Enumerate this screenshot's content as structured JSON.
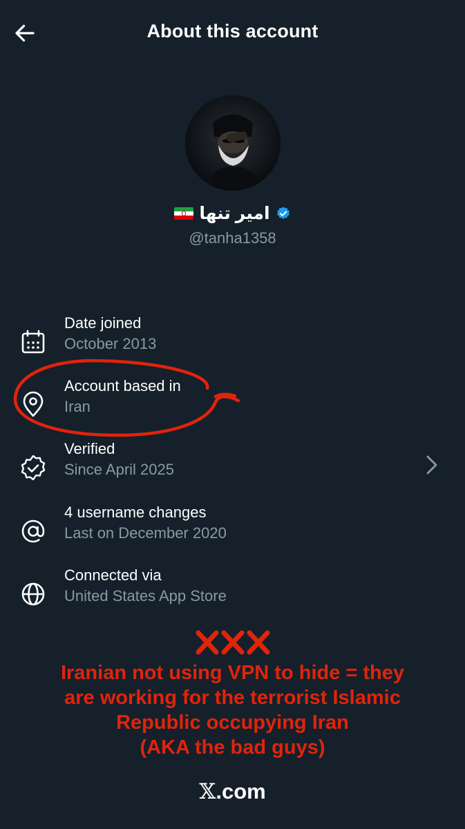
{
  "header": {
    "title": "About this account",
    "back_icon": "arrow-left-icon"
  },
  "profile": {
    "display_name": "امیر تنها",
    "flag": "iran-flag-icon",
    "verified_icon": "verified-badge-icon",
    "handle": "@tanha1358"
  },
  "details": [
    {
      "icon": "calendar-icon",
      "label": "Date joined",
      "value": "October 2013"
    },
    {
      "icon": "location-pin-icon",
      "label": "Account based in",
      "value": "Iran"
    },
    {
      "icon": "verified-badge-outline-icon",
      "label": "Verified",
      "value": "Since April 2025"
    },
    {
      "icon": "at-sign-icon",
      "label": "4 username changes",
      "value": "Last on December 2020"
    },
    {
      "icon": "globe-icon",
      "label": "Connected via",
      "value": "United States App Store"
    }
  ],
  "annotation": {
    "marks": "❌❌❌",
    "lines": [
      "Iranian not using VPN to hide = they",
      "are working for the terrorist Islamic",
      "Republic occupying Iran",
      "(AKA the bad guys)"
    ],
    "color": "#e0240b"
  },
  "footer": {
    "logo": "𝕏",
    "domain": ".com"
  },
  "colors": {
    "background": "#15202b",
    "secondary_text": "#8b98a5",
    "verified_blue": "#1d9bf0"
  }
}
